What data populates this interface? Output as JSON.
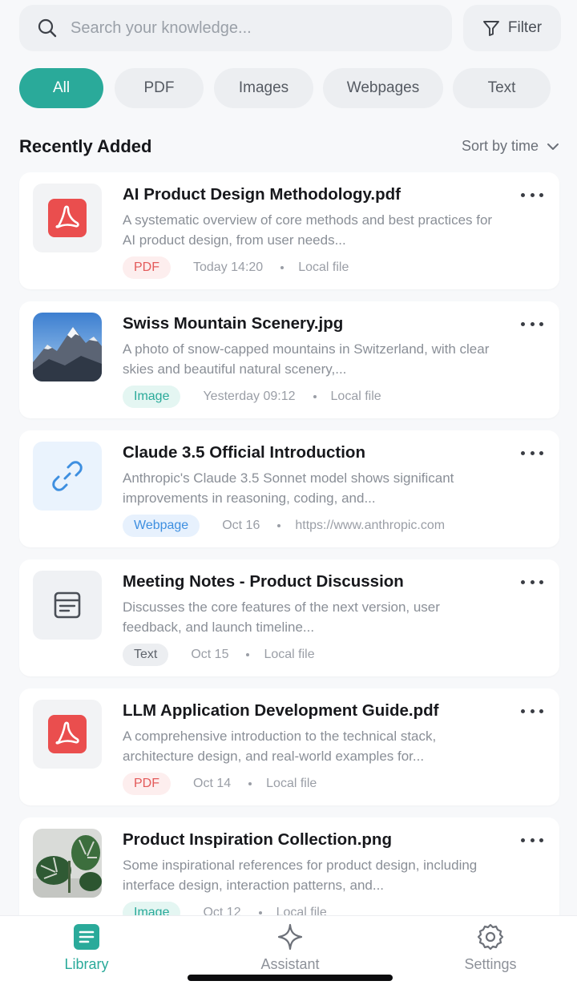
{
  "search": {
    "placeholder": "Search your knowledge...",
    "filter_label": "Filter"
  },
  "chips": [
    {
      "label": "All",
      "active": true
    },
    {
      "label": "PDF",
      "active": false
    },
    {
      "label": "Images",
      "active": false
    },
    {
      "label": "Webpages",
      "active": false
    },
    {
      "label": "Text",
      "active": false
    }
  ],
  "section": {
    "title": "Recently Added",
    "sort_label": "Sort by time"
  },
  "items": [
    {
      "title": "AI Product Design Methodology.pdf",
      "description": "A systematic overview of core methods and best practices for AI product design, from user needs...",
      "badge": "PDF",
      "date": "Today 14:20",
      "source": "Local file",
      "icon": "pdf-icon"
    },
    {
      "title": "Swiss Mountain Scenery.jpg",
      "description": "A photo of snow-capped mountains in Switzerland, with clear skies and beautiful natural scenery,...",
      "badge": "Image",
      "date": "Yesterday 09:12",
      "source": "Local file",
      "icon": "mountain-image"
    },
    {
      "title": "Claude 3.5 Official Introduction",
      "description": "Anthropic's Claude 3.5 Sonnet model shows significant improvements in reasoning, coding, and...",
      "badge": "Webpage",
      "date": "Oct 16",
      "source": "https://www.anthropic.com",
      "icon": "link-icon"
    },
    {
      "title": "Meeting Notes - Product Discussion",
      "description": "Discusses the core features of the next version, user feedback, and launch timeline...",
      "badge": "Text",
      "date": "Oct 15",
      "source": "Local file",
      "icon": "document-icon"
    },
    {
      "title": "LLM Application Development Guide.pdf",
      "description": "A comprehensive introduction to the technical stack, architecture design, and real-world examples for...",
      "badge": "PDF",
      "date": "Oct 14",
      "source": "Local file",
      "icon": "pdf-icon"
    },
    {
      "title": "Product Inspiration Collection.png",
      "description": "Some inspirational references for product design, including interface design, interaction patterns, and...",
      "badge": "Image",
      "date": "Oct 12",
      "source": "Local file",
      "icon": "plant-image"
    }
  ],
  "nav": [
    {
      "label": "Library",
      "icon": "library-icon",
      "active": true
    },
    {
      "label": "Assistant",
      "icon": "sparkle-icon",
      "active": false
    },
    {
      "label": "Settings",
      "icon": "gear-icon",
      "active": false
    }
  ],
  "colors": {
    "accent": "#2aaa9a",
    "pdf": "#e35a5a",
    "web": "#3e8fe0"
  }
}
